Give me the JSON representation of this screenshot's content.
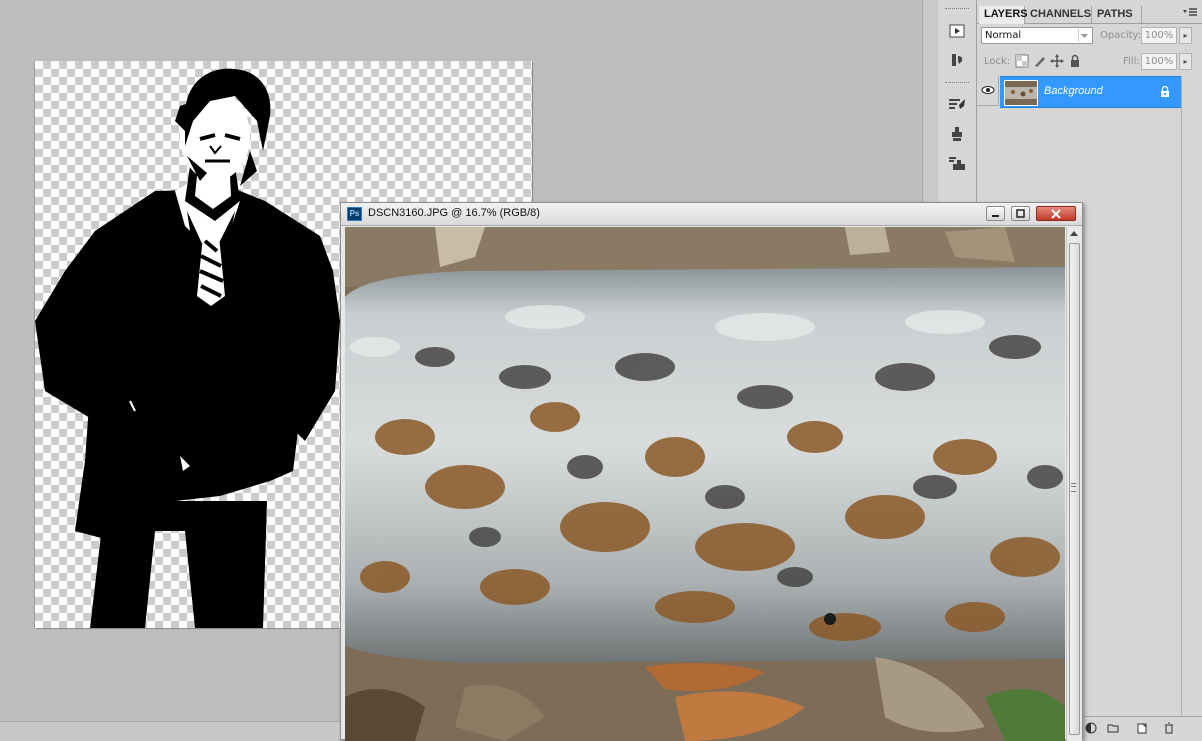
{
  "panel": {
    "tabs": [
      "LAYERS",
      "CHANNELS",
      "PATHS"
    ],
    "active_tab": "LAYERS",
    "blend_mode": "Normal",
    "opacity_label": "Opacity:",
    "opacity_value": "100%",
    "lock_label": "Lock:",
    "fill_label": "Fill:",
    "fill_value": "100%",
    "layers": [
      {
        "name": "Background",
        "visible": true,
        "locked": true,
        "selected": true
      }
    ]
  },
  "tool_strip": {
    "icons": [
      "play-action-icon",
      "brush-swap-icon",
      "brush-presets-icon",
      "clone-source-icon",
      "tool-presets-icon"
    ]
  },
  "document_window": {
    "app_badge": "Ps",
    "title": "DSCN3160.JPG @ 16.7% (RGB/8)",
    "buttons": [
      "minimize",
      "restore",
      "close"
    ]
  },
  "colors": {
    "workspace": "#bdbdbd",
    "panel": "#d6d6d6",
    "selection": "#3399ff",
    "close_button": "#c2392b"
  }
}
